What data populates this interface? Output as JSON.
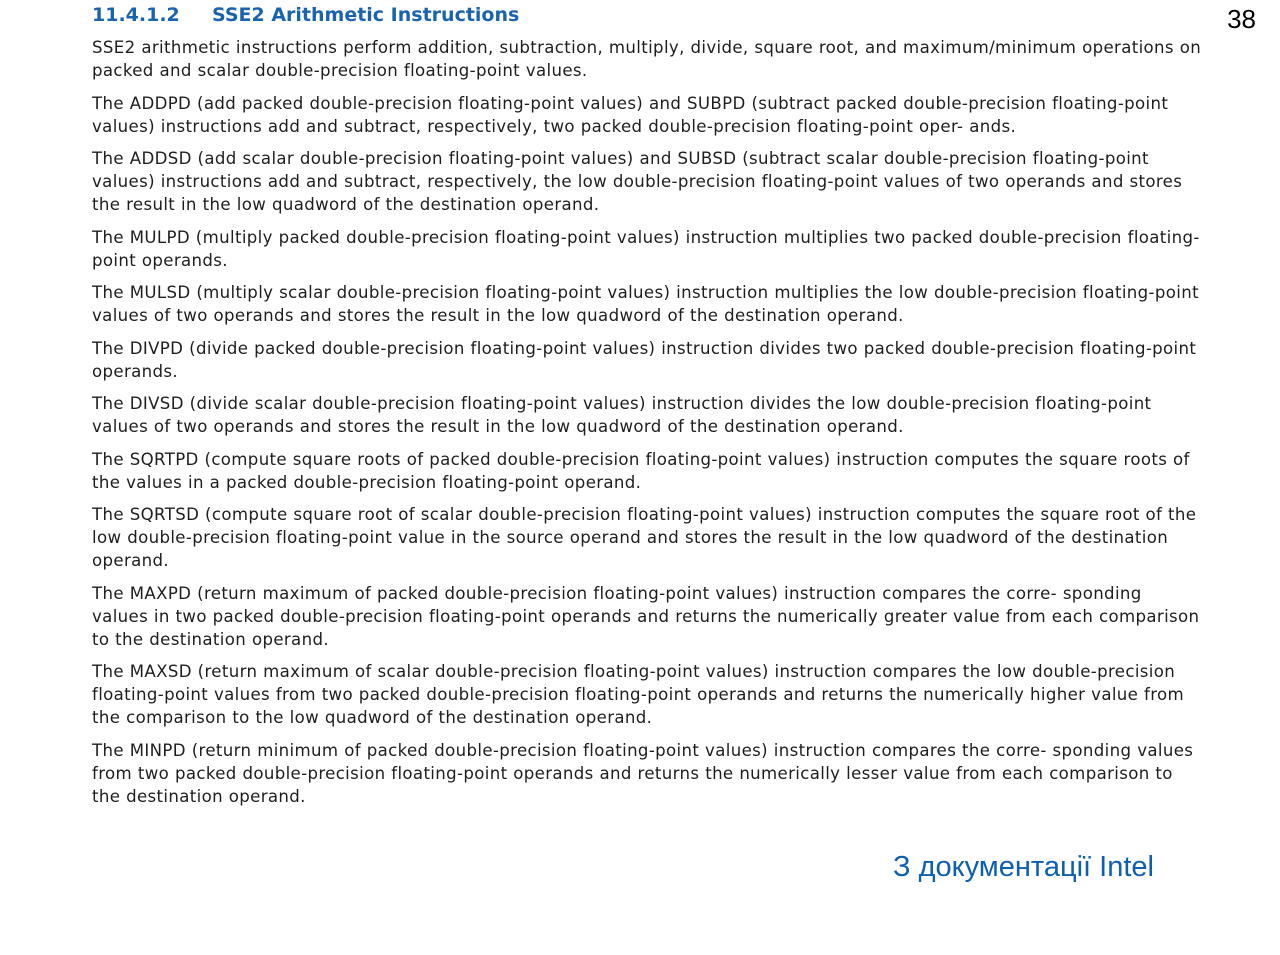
{
  "page_number": "38",
  "section": {
    "number": "11.4.1.2",
    "title": "SSE2 Arithmetic Instructions"
  },
  "paragraphs": [
    "SSE2 arithmetic instructions perform addition, subtraction, multiply, divide, square root, and maximum/minimum operations on packed and scalar double-precision floating-point values.",
    "The ADDPD (add packed double-precision floating-point values) and SUBPD (subtract packed double-precision floating-point values) instructions add and subtract, respectively, two packed double-precision floating-point oper- ands.",
    "The ADDSD (add scalar double-precision floating-point values) and SUBSD (subtract scalar double-precision floating-point values) instructions add and subtract, respectively, the low double-precision floating-point values of two operands and stores the result in the low quadword of the destination operand.",
    "The MULPD (multiply packed double-precision floating-point values) instruction multiplies two packed double-precision floating-point operands.",
    "The MULSD (multiply scalar double-precision floating-point values) instruction multiplies the low double-precision floating-point values of two operands and stores the result in the low quadword of the destination operand.",
    "The DIVPD (divide packed double-precision floating-point values) instruction divides two packed double-precision floating-point operands.",
    "The DIVSD (divide scalar double-precision floating-point values) instruction divides the low double-precision floating-point values of two operands and stores the result in the low quadword of the destination operand.",
    "The SQRTPD (compute square roots of packed double-precision floating-point values) instruction computes the square roots of the values in a packed double-precision floating-point operand.",
    "The SQRTSD (compute square root of scalar double-precision floating-point values) instruction computes the square root of the low double-precision floating-point value in the source operand and stores the result in the low quadword of the destination operand.",
    "The MAXPD (return maximum of packed double-precision floating-point values) instruction compares the corre- sponding values in two packed double-precision floating-point operands and returns the numerically greater value from each comparison to the destination operand.",
    "The MAXSD (return maximum of scalar double-precision floating-point values) instruction compares the low double-precision floating-point values from two packed double-precision floating-point operands and returns the numerically higher value from the comparison to the low quadword of the destination operand.",
    "The MINPD (return minimum of packed double-precision floating-point values) instruction compares the corre- sponding values from two packed double-precision floating-point operands and returns the numerically lesser value from each comparison to the destination operand."
  ],
  "caption": "З документації Intel",
  "colors": {
    "heading": "#1a64ad",
    "caption": "#0d5fb3",
    "body_text": "#1e1e1e"
  }
}
